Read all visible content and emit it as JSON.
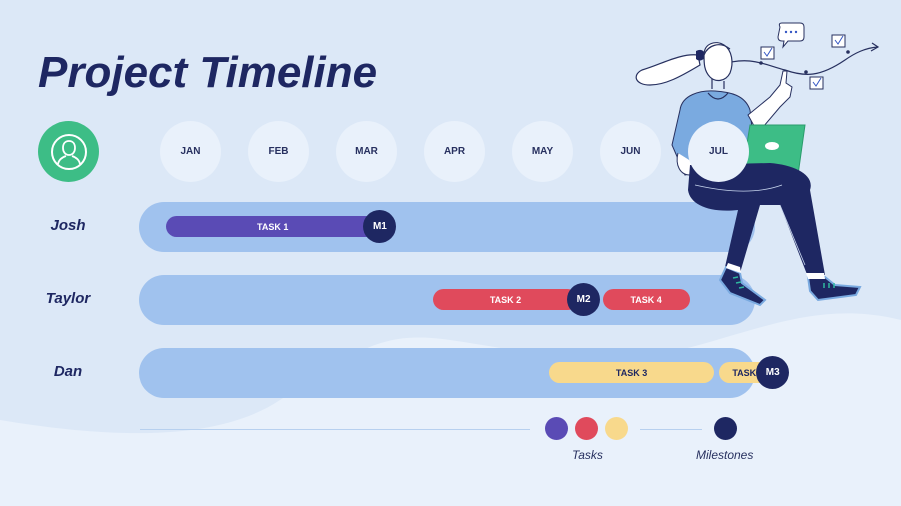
{
  "title": "Project Timeline",
  "header": {
    "user_icon": "user-circle-icon",
    "user_badge_color": "#3dbd86"
  },
  "chart_data": {
    "type": "gantt",
    "title": "Project Timeline",
    "months": [
      "JAN",
      "FEB",
      "MAR",
      "APR",
      "MAY",
      "JUN",
      "JUL"
    ],
    "rows": [
      {
        "name": "Josh",
        "tasks": [
          {
            "label": "TASK 1",
            "start_month": 0.0,
            "end_month": 2.2,
            "color": "#5a4bb5",
            "text_color": "#ffffff"
          }
        ],
        "milestones": [
          {
            "label": "M1",
            "month": 2.2
          }
        ]
      },
      {
        "name": "Taylor",
        "tasks": [
          {
            "label": "TASK 2",
            "start_month": 2.75,
            "end_month": 4.25,
            "color": "#e04a5c",
            "text_color": "#ffffff"
          },
          {
            "label": "TASK 4",
            "start_month": 4.5,
            "end_month": 5.4,
            "color": "#e04a5c",
            "text_color": "#ffffff"
          }
        ],
        "milestones": [
          {
            "label": "M2",
            "month": 4.3
          }
        ]
      },
      {
        "name": "Dan",
        "tasks": [
          {
            "label": "TASK 3",
            "start_month": 3.95,
            "end_month": 5.65,
            "color": "#f8d98c",
            "text_color": "#1e2762"
          },
          {
            "label": "TASK 5",
            "start_month": 5.7,
            "end_month": 6.3,
            "color": "#f8d98c",
            "text_color": "#1e2762"
          }
        ],
        "milestones": [
          {
            "label": "M3",
            "month": 6.25
          }
        ]
      }
    ],
    "legend": {
      "tasks_label": "Tasks",
      "tasks_colors": [
        "#5a4bb5",
        "#e04a5c",
        "#f8d98c"
      ],
      "milestones_label": "Milestones",
      "milestone_color": "#1e2762",
      "placement": "bottom-right"
    }
  },
  "colors": {
    "background": "#dce8f7",
    "track": "#a0c2ee",
    "month_circle": "#e9f1fb",
    "title": "#1e2762"
  }
}
